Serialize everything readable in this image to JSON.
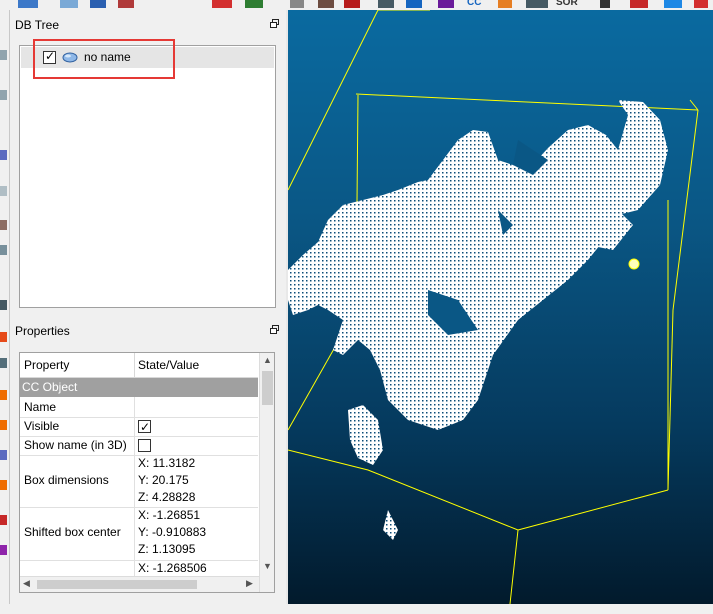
{
  "panels": {
    "db_tree": {
      "title": "DB Tree",
      "items": [
        {
          "label": "no name",
          "checked": true,
          "icon": "point-cloud-icon"
        }
      ]
    },
    "properties": {
      "title": "Properties",
      "header": {
        "col1": "Property",
        "col2": "State/Value"
      },
      "section": "CC Object",
      "rows": {
        "name": {
          "key": "Name",
          "value": ""
        },
        "visible": {
          "key": "Visible",
          "checked": true
        },
        "show_name": {
          "key": "Show name (in 3D)",
          "checked": false
        },
        "box_dimensions": {
          "key": "Box dimensions",
          "x": "X: 11.3182",
          "y": "Y: 20.175",
          "z": "Z: 4.28828"
        },
        "shifted_box_center": {
          "key": "Shifted box center",
          "x": "X: -1.26851",
          "y": "Y: -0.910883",
          "z": "Z: 1.13095"
        },
        "next_partial": {
          "x": "X: -1.268506"
        }
      }
    }
  },
  "toolbar": {
    "visible_text": [
      "CC",
      "SOR"
    ]
  },
  "colors": {
    "highlight": "#e53935",
    "bbox": "#ffff00",
    "cloud": "#ffffff",
    "view_top": "#0a6aa0",
    "view_bottom": "#021a2c"
  }
}
